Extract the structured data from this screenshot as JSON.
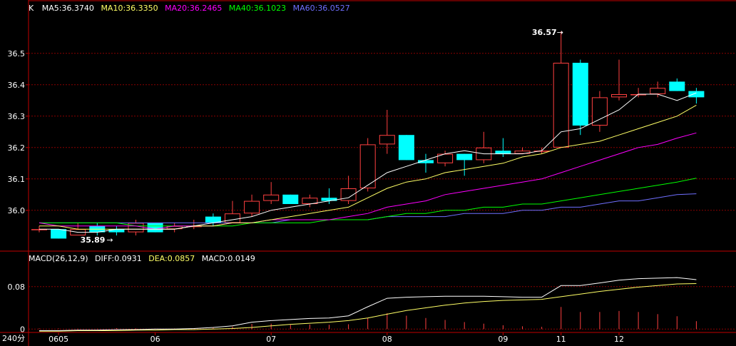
{
  "main_legend": {
    "prefix": "K",
    "ma5": "MA5:36.3740",
    "ma10": "MA10:36.3350",
    "ma20": "MA20:36.2465",
    "ma40": "MA40:36.1023",
    "ma60": "MA60:36.0527"
  },
  "macd_legend": {
    "title": "MACD(26,12,9)",
    "diff": "DIFF:0.0931",
    "dea": "DEA:0.0857",
    "macd": "MACD:0.0149"
  },
  "annotations": {
    "high": "36.57",
    "low": "35.89"
  },
  "period_label": "240分",
  "colors": {
    "up": "#ff4040",
    "down": "#00ffff",
    "ma5": "#ffffff",
    "ma10": "#ffff66",
    "ma20": "#ff00ff",
    "ma40": "#00ff00",
    "ma60": "#6f6fff",
    "grid": "#8b0000",
    "axis": "#c00000"
  },
  "chart_data": {
    "type": "candlestick",
    "x_tick_labels": [
      {
        "index": 1,
        "label": "0605"
      },
      {
        "index": 6,
        "label": "06"
      },
      {
        "index": 12,
        "label": "07"
      },
      {
        "index": 18,
        "label": "08"
      },
      {
        "index": 24,
        "label": "09"
      },
      {
        "index": 27,
        "label": "11"
      },
      {
        "index": 30,
        "label": "12"
      }
    ],
    "price_axis": {
      "ticks": [
        36.5,
        36.4,
        36.3,
        36.2,
        36.1,
        36.0
      ],
      "ylim": [
        35.87,
        36.62
      ]
    },
    "macd_axis": {
      "ticks": [
        0.08,
        0
      ],
      "ylim": [
        -0.005,
        0.12
      ]
    },
    "candles": [
      {
        "o": 35.94,
        "h": 35.95,
        "l": 35.93,
        "c": 35.94
      },
      {
        "o": 35.94,
        "h": 35.94,
        "l": 35.91,
        "c": 35.91
      },
      {
        "o": 35.92,
        "h": 35.96,
        "l": 35.92,
        "c": 35.94
      },
      {
        "o": 35.95,
        "h": 35.96,
        "l": 35.92,
        "c": 35.93
      },
      {
        "o": 35.94,
        "h": 35.95,
        "l": 35.92,
        "c": 35.93
      },
      {
        "o": 35.93,
        "h": 35.97,
        "l": 35.92,
        "c": 35.96
      },
      {
        "o": 35.96,
        "h": 35.96,
        "l": 35.93,
        "c": 35.93
      },
      {
        "o": 35.94,
        "h": 35.96,
        "l": 35.93,
        "c": 35.95
      },
      {
        "o": 35.95,
        "h": 35.97,
        "l": 35.94,
        "c": 35.95
      },
      {
        "o": 35.98,
        "h": 35.99,
        "l": 35.95,
        "c": 35.96
      },
      {
        "o": 35.96,
        "h": 36.03,
        "l": 35.96,
        "c": 35.99
      },
      {
        "o": 35.99,
        "h": 36.05,
        "l": 35.98,
        "c": 36.03
      },
      {
        "o": 36.03,
        "h": 36.09,
        "l": 36.02,
        "c": 36.05
      },
      {
        "o": 36.05,
        "h": 36.05,
        "l": 36.02,
        "c": 36.02
      },
      {
        "o": 36.02,
        "h": 36.05,
        "l": 36.01,
        "c": 36.04
      },
      {
        "o": 36.04,
        "h": 36.07,
        "l": 36.02,
        "c": 36.03
      },
      {
        "o": 36.03,
        "h": 36.11,
        "l": 36.02,
        "c": 36.07
      },
      {
        "o": 36.07,
        "h": 36.23,
        "l": 36.06,
        "c": 36.21
      },
      {
        "o": 36.21,
        "h": 36.32,
        "l": 36.18,
        "c": 36.24
      },
      {
        "o": 36.24,
        "h": 36.24,
        "l": 36.16,
        "c": 36.16
      },
      {
        "o": 36.16,
        "h": 36.18,
        "l": 36.12,
        "c": 36.15
      },
      {
        "o": 36.15,
        "h": 36.19,
        "l": 36.14,
        "c": 36.18
      },
      {
        "o": 36.18,
        "h": 36.18,
        "l": 36.11,
        "c": 36.16
      },
      {
        "o": 36.16,
        "h": 36.25,
        "l": 36.15,
        "c": 36.2
      },
      {
        "o": 36.19,
        "h": 36.23,
        "l": 36.17,
        "c": 36.18
      },
      {
        "o": 36.18,
        "h": 36.2,
        "l": 36.18,
        "c": 36.19
      },
      {
        "o": 36.19,
        "h": 36.2,
        "l": 36.18,
        "c": 36.19
      },
      {
        "o": 36.2,
        "h": 36.57,
        "l": 36.2,
        "c": 36.47
      },
      {
        "o": 36.47,
        "h": 36.48,
        "l": 36.24,
        "c": 36.27
      },
      {
        "o": 36.27,
        "h": 36.38,
        "l": 36.25,
        "c": 36.36
      },
      {
        "o": 36.36,
        "h": 36.48,
        "l": 36.35,
        "c": 36.37
      },
      {
        "o": 36.37,
        "h": 36.39,
        "l": 36.36,
        "c": 36.37
      },
      {
        "o": 36.37,
        "h": 36.41,
        "l": 36.36,
        "c": 36.39
      },
      {
        "o": 36.41,
        "h": 36.42,
        "l": 36.38,
        "c": 36.38
      },
      {
        "o": 36.38,
        "h": 36.39,
        "l": 36.34,
        "c": 36.36
      }
    ],
    "ma5": [
      35.94,
      35.94,
      35.93,
      35.93,
      35.94,
      35.94,
      35.94,
      35.94,
      35.95,
      35.96,
      35.97,
      35.98,
      36.0,
      36.01,
      36.02,
      36.03,
      36.04,
      36.08,
      36.12,
      36.14,
      36.16,
      36.18,
      36.19,
      36.18,
      36.18,
      36.18,
      36.19,
      36.25,
      36.26,
      36.29,
      36.32,
      36.37,
      36.37,
      36.35,
      36.374
    ],
    "ma10": [
      35.95,
      35.95,
      35.94,
      35.94,
      35.94,
      35.94,
      35.94,
      35.94,
      35.95,
      35.95,
      35.96,
      35.96,
      35.97,
      35.98,
      35.99,
      36.0,
      36.01,
      36.04,
      36.07,
      36.09,
      36.1,
      36.12,
      36.13,
      36.14,
      36.15,
      36.17,
      36.18,
      36.2,
      36.21,
      36.22,
      36.24,
      36.26,
      36.28,
      36.3,
      36.335
    ],
    "ma20": [
      35.96,
      35.95,
      35.95,
      35.95,
      35.95,
      35.95,
      35.94,
      35.95,
      35.95,
      35.95,
      35.96,
      35.96,
      35.97,
      35.97,
      35.97,
      35.97,
      35.98,
      35.99,
      36.01,
      36.02,
      36.03,
      36.05,
      36.06,
      36.07,
      36.08,
      36.09,
      36.1,
      36.12,
      36.14,
      36.16,
      36.18,
      36.2,
      36.21,
      36.23,
      36.2465
    ],
    "ma40": [
      35.96,
      35.96,
      35.96,
      35.96,
      35.96,
      35.95,
      35.95,
      35.95,
      35.95,
      35.95,
      35.95,
      35.96,
      35.96,
      35.96,
      35.96,
      35.97,
      35.97,
      35.97,
      35.98,
      35.99,
      35.99,
      36.0,
      36.0,
      36.01,
      36.01,
      36.02,
      36.02,
      36.03,
      36.04,
      36.05,
      36.06,
      36.07,
      36.08,
      36.09,
      36.1023
    ],
    "ma60": [
      35.96,
      35.96,
      35.96,
      35.96,
      35.96,
      35.96,
      35.96,
      35.96,
      35.96,
      35.96,
      35.96,
      35.96,
      35.96,
      35.97,
      35.97,
      35.97,
      35.97,
      35.97,
      35.98,
      35.98,
      35.98,
      35.98,
      35.99,
      35.99,
      35.99,
      36.0,
      36.0,
      36.01,
      36.01,
      36.02,
      36.03,
      36.03,
      36.04,
      36.05,
      36.0527
    ],
    "diff": [
      -0.003,
      -0.003,
      -0.002,
      -0.002,
      -0.001,
      -0.001,
      0.0,
      0.0,
      0.001,
      0.003,
      0.006,
      0.013,
      0.016,
      0.018,
      0.02,
      0.021,
      0.025,
      0.042,
      0.058,
      0.06,
      0.061,
      0.062,
      0.062,
      0.062,
      0.061,
      0.06,
      0.06,
      0.082,
      0.082,
      0.087,
      0.092,
      0.095,
      0.096,
      0.097,
      0.0931
    ],
    "dea": [
      -0.004,
      -0.004,
      -0.003,
      -0.003,
      -0.003,
      -0.002,
      -0.002,
      -0.001,
      -0.001,
      0.0,
      0.001,
      0.003,
      0.006,
      0.009,
      0.011,
      0.013,
      0.016,
      0.021,
      0.028,
      0.035,
      0.04,
      0.045,
      0.049,
      0.052,
      0.054,
      0.055,
      0.056,
      0.061,
      0.066,
      0.071,
      0.075,
      0.079,
      0.082,
      0.085,
      0.0857
    ],
    "macd_bars": [
      0.0013,
      0.0011,
      0.0009,
      0.0008,
      0.0017,
      0.0012,
      0.0006,
      0.0011,
      0.0011,
      0.0029,
      0.0046,
      0.0097,
      0.0102,
      0.0081,
      0.0087,
      0.0081,
      0.0091,
      0.0212,
      0.0299,
      0.0252,
      0.0208,
      0.0172,
      0.0132,
      0.0102,
      0.0072,
      0.0052,
      0.0042,
      0.0417,
      0.0322,
      0.0322,
      0.0342,
      0.0322,
      0.0282,
      0.0242,
      0.0149
    ]
  }
}
